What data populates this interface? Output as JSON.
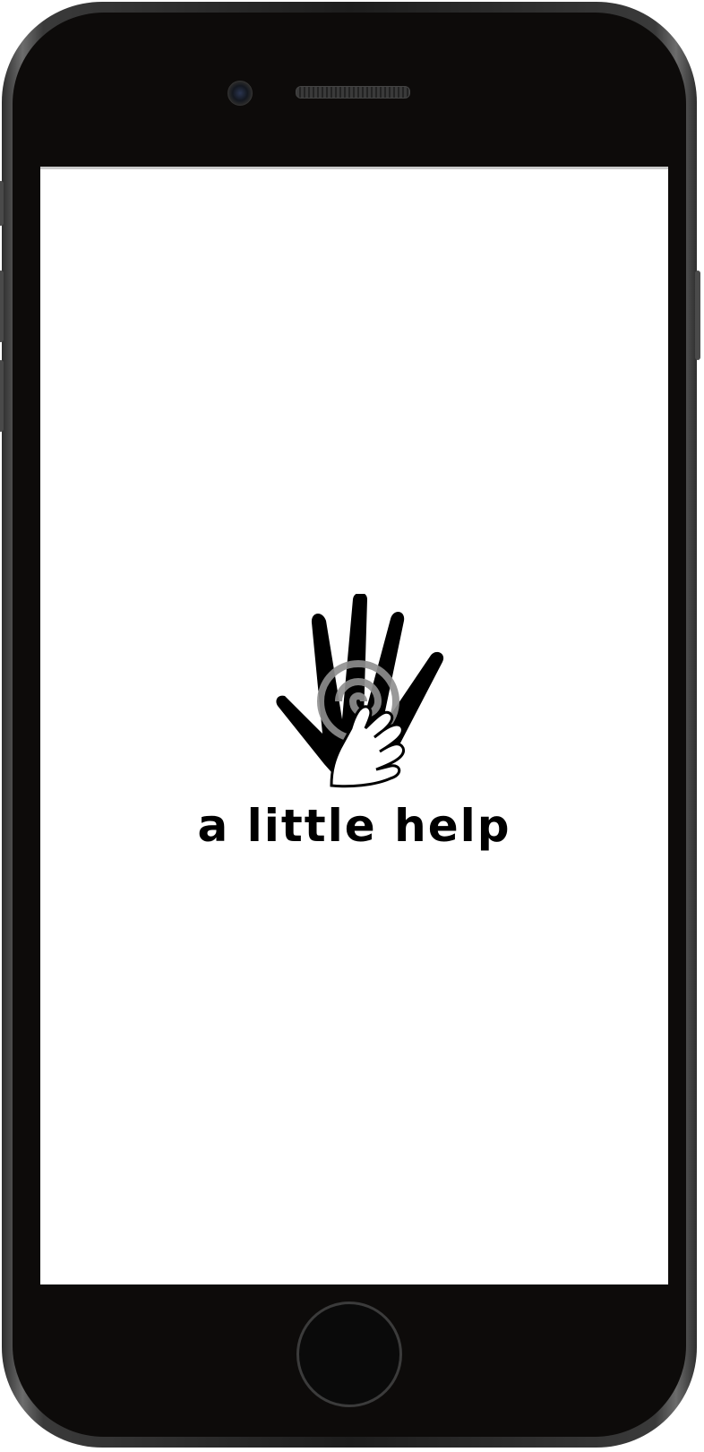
{
  "app": {
    "name": "a little help",
    "logo_icon": "hands-icon"
  },
  "colors": {
    "frame": "#1d1d1d",
    "bezel": "#0d0b0a",
    "screen_background": "#ffffff",
    "text": "#000000"
  }
}
